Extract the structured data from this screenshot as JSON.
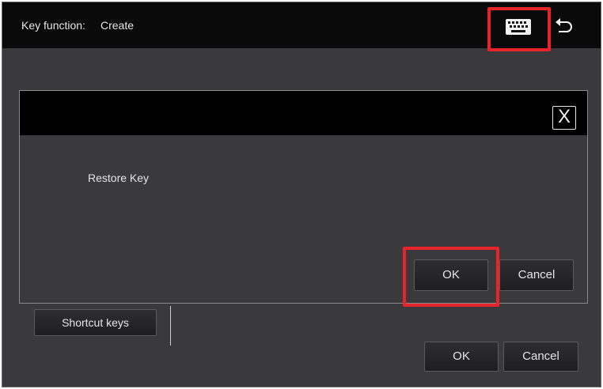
{
  "header": {
    "key_function_label": "Key function:",
    "key_function_value": "Create",
    "keyboard_icon": "keyboard-icon",
    "back_icon": "back-arrow-icon"
  },
  "dialog": {
    "close_label": "X",
    "message": "Restore Key",
    "ok_label": "OK",
    "cancel_label": "Cancel"
  },
  "footer": {
    "shortcut_label": "Shortcut keys",
    "ok_label": "OK",
    "cancel_label": "Cancel"
  },
  "colors": {
    "background": "#3a3a3c",
    "titlebar": "#0a0a0a",
    "text": "#e6e6e6",
    "highlight": "#e8242a"
  }
}
